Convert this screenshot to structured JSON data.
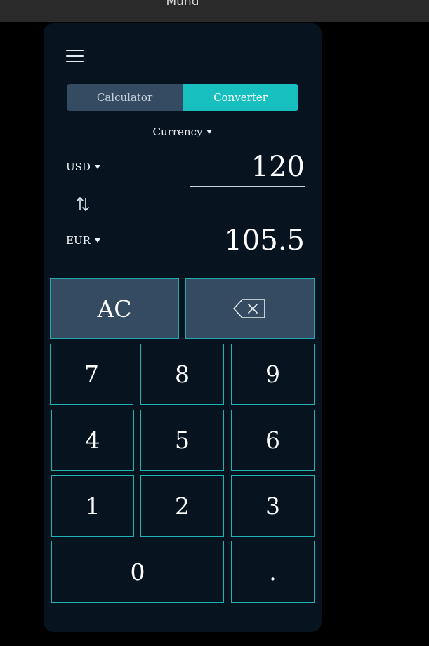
{
  "window": {
    "title": "Mund"
  },
  "header": {
    "menu_icon": "hamburger-menu-icon"
  },
  "tabs": [
    {
      "label": "Calculator",
      "active": false
    },
    {
      "label": "Converter",
      "active": true
    }
  ],
  "converter": {
    "mode": "Currency",
    "from": {
      "unit": "USD",
      "value": "120"
    },
    "to": {
      "unit": "EUR",
      "value": "105.5"
    },
    "swap_icon": "swap-vertical-arrows-icon"
  },
  "keypad": {
    "clear": "AC",
    "backspace_icon": "backspace-icon",
    "keys": [
      "7",
      "8",
      "9",
      "4",
      "5",
      "6",
      "1",
      "2",
      "3",
      "0",
      "."
    ]
  },
  "colors": {
    "background": "#000000",
    "panel": "#081320",
    "accent": "#17bfbf",
    "tab_inactive": "#354b61",
    "key_border": "#1fb3b3"
  }
}
